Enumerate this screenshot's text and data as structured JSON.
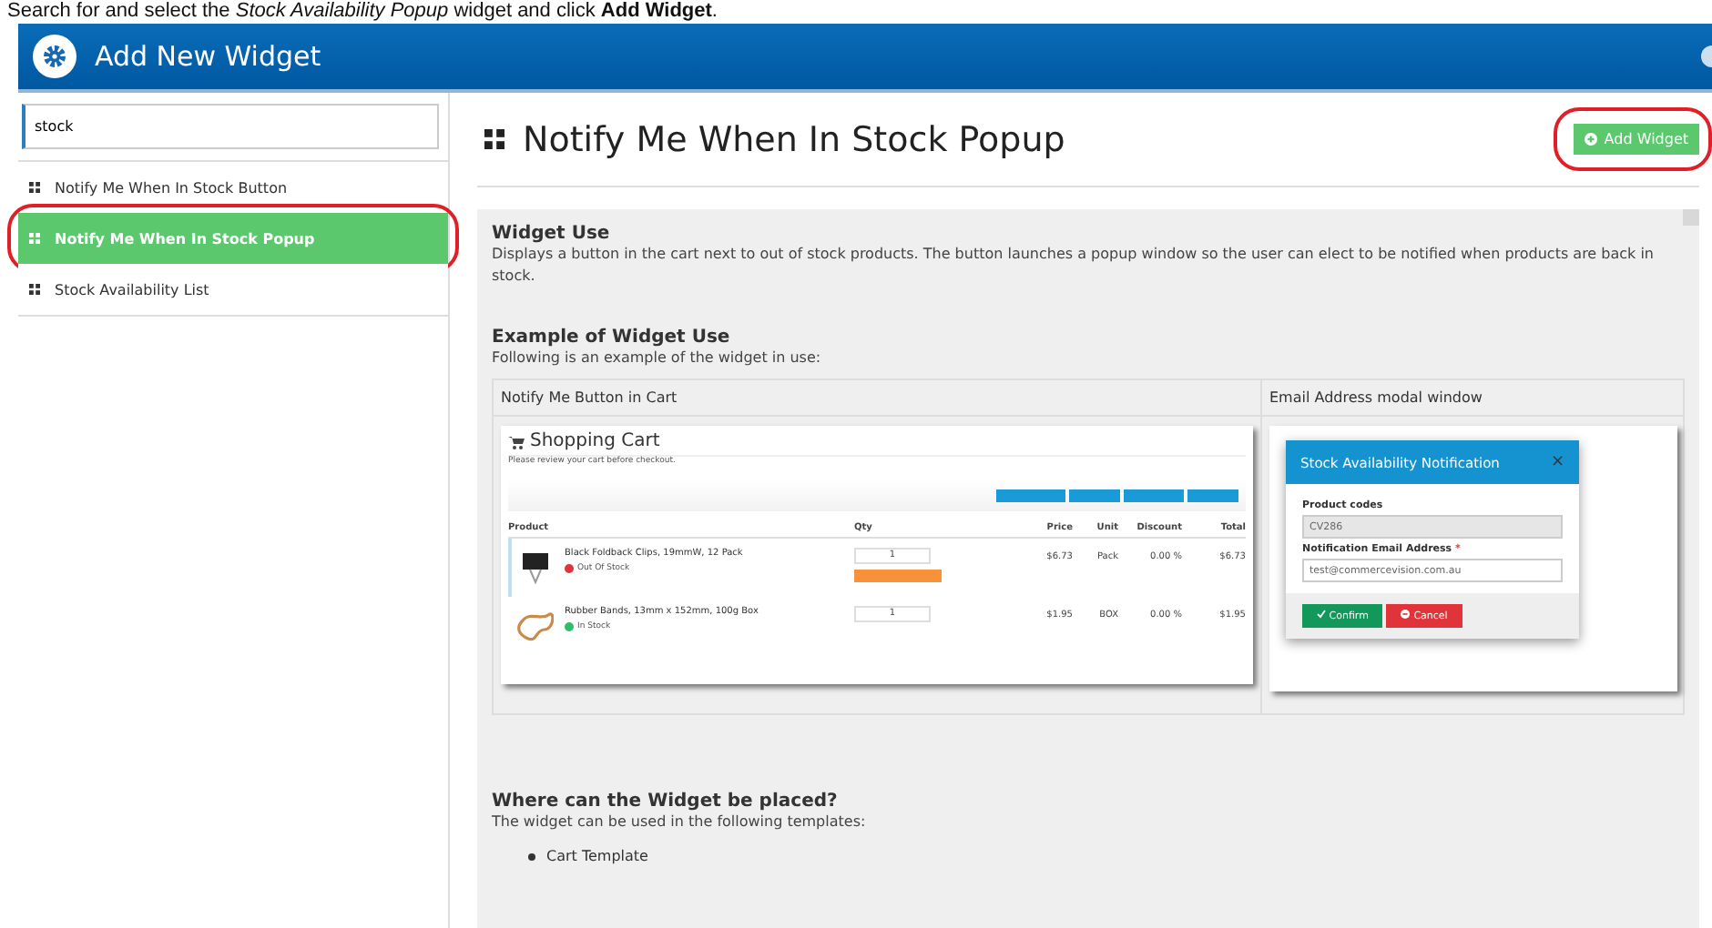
{
  "instruction": "Search for and select the *Stock Availability Popup* widget and click **Add Widget**.",
  "window": {
    "title": "Add New Widget"
  },
  "search": {
    "value": "stock"
  },
  "widgets": [
    {
      "label": "Notify Me When In Stock Button",
      "selected": false,
      "circled": false
    },
    {
      "label": "Notify Me When In Stock Popup",
      "selected": true,
      "circled": true
    },
    {
      "label": "Stock Availability List",
      "selected": false,
      "circled": false
    }
  ],
  "detail": {
    "title": "Notify Me When In Stock Popup",
    "add_button": {
      "label": "Add Widget",
      "circled": true
    },
    "use_heading": "Widget Use",
    "use_text": "Displays a button in the cart next to out of stock products. The button launches a popup window so the user can elect to be notified when products are back in stock.",
    "example_heading": "Example of Widget Use",
    "example_text": "Following is an example of the widget in use:",
    "example_columns": [
      "Notify Me Button in Cart",
      "Email Address modal window"
    ],
    "cart": {
      "title": "Shopping Cart",
      "note": "Please review your cart before checkout.",
      "columns": [
        "Product",
        "Qty",
        "Price",
        "Unit",
        "Discount",
        "Total"
      ],
      "rows": [
        {
          "name": "Black Foldback Clips, 19mmW, 12 Pack",
          "status": "Out Of Stock",
          "in_stock": false,
          "qty": "1",
          "price": "$6.73",
          "unit": "Pack",
          "discount": "0.00 %",
          "total": "$6.73"
        },
        {
          "name": "Rubber Bands, 13mm x 152mm, 100g Box",
          "status": "In Stock",
          "in_stock": true,
          "qty": "1",
          "price": "$1.95",
          "unit": "BOX",
          "discount": "0.00 %",
          "total": "$1.95"
        }
      ]
    },
    "modal": {
      "title": "Stock Availability Notification",
      "close": "×",
      "code_label": "Product codes",
      "code_value": "CV286",
      "email_label": "Notification Email Address",
      "required": "*",
      "email_value": "test@commercevision.com.au",
      "confirm": "Confirm",
      "cancel": "Cancel"
    },
    "placement_heading": "Where can the Widget be placed?",
    "placement_text": "The widget can be used in the following templates:",
    "templates": [
      "Cart Template"
    ]
  }
}
